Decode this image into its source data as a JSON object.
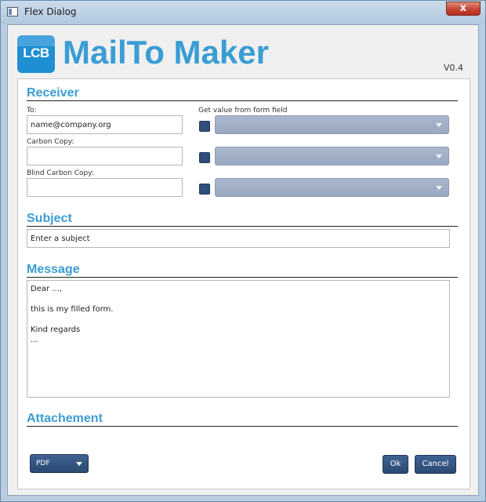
{
  "window": {
    "title": "Flex Dialog",
    "close_glyph": "x"
  },
  "header": {
    "logo_text": "LCB",
    "app_title": "MailTo Maker",
    "version": "V0.4"
  },
  "receiver": {
    "section_title": "Receiver",
    "to_label": "To:",
    "to_value": "name@company.org",
    "cc_label": "Carbon Copy:",
    "cc_value": "",
    "bcc_label": "Blind Carbon Copy:",
    "bcc_value": "",
    "form_field_label": "Get value from form field"
  },
  "subject": {
    "section_title": "Subject",
    "placeholder": "Enter a subject"
  },
  "message": {
    "section_title": "Message",
    "text": "Dear ...,\n\nthis is my filled form.\n\nKind regards\n..."
  },
  "attachment": {
    "section_title": "Attachement",
    "format": "PDF"
  },
  "footer": {
    "ok_label": "Ok",
    "cancel_label": "Cancel"
  },
  "colors": {
    "accent": "#3a9dd4",
    "button": "#2f4e7a",
    "dropdown": "#a4b1c6"
  }
}
